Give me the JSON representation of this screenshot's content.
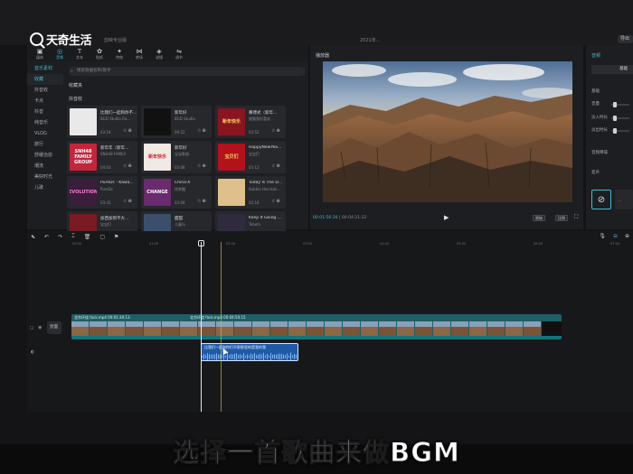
{
  "watermark": {
    "logo_text": "天奇生活"
  },
  "window": {
    "title": "剪映专业版",
    "project": "2021年..."
  },
  "header": {
    "export_label": "导出"
  },
  "media_panel": {
    "tools": [
      {
        "icon": "▣",
        "label": "媒体"
      },
      {
        "icon": "◎",
        "label": "音频"
      },
      {
        "icon": "T",
        "label": "文本"
      },
      {
        "icon": "✿",
        "label": "贴纸"
      },
      {
        "icon": "✦",
        "label": "特效"
      },
      {
        "icon": "⋈",
        "label": "转场"
      },
      {
        "icon": "◈",
        "label": "滤镜"
      },
      {
        "icon": "⇋",
        "label": "调节"
      }
    ],
    "categories": [
      "音乐素材",
      "收藏",
      "抖音收",
      "卡点",
      "抖音",
      "纯音乐",
      "VLOG",
      "旅行",
      "舒缓治愈",
      "潮流",
      "美好时光",
      "儿歌"
    ],
    "search_placeholder": "搜索歌曲名称/歌手",
    "section_recent": "收藏夹",
    "section_list": "抖音收",
    "tracks": [
      {
        "title": "比我们一起和你不...",
        "artist": "BGD Studio Ra...",
        "duration": "03:14"
      },
      {
        "title": "新年好",
        "artist": "BGD Studio",
        "duration": "00:22"
      },
      {
        "title": "赛博式（新年...",
        "artist": "猫猫我好喜欢...",
        "duration": "03:52"
      },
      {
        "title": "新年年（新年...",
        "artist": "SNH48 FAMILY",
        "duration": "04:03"
      },
      {
        "title": "新年好",
        "artist": "宝宝歌曲",
        "duration": "03:08"
      },
      {
        "title": "HappyNewYea...",
        "artist": "宝宝们",
        "duration": "03:12"
      },
      {
        "title": "PureDc - Kawa...",
        "artist": "PureDc",
        "duration": "03:41"
      },
      {
        "title": "China-X",
        "artist": "徐梦圆",
        "duration": "03:08"
      },
      {
        "title": "Today Is The D...",
        "artist": "Robbie Harrisok...",
        "duration": "02:16"
      },
      {
        "title": "加西加到不大...",
        "artist": "宝宝们",
        "duration": "03:15"
      },
      {
        "title": "甜甜",
        "artist": "儿童乐",
        "duration": "03:21"
      },
      {
        "title": "Keep It Going ...",
        "artist": "Tobela",
        "duration": "02:05"
      }
    ],
    "thumb_texts": [
      "",
      "",
      "新年快乐",
      "SNH48 FAMILY GROUP",
      "新年快乐",
      "宝贝们",
      "EVOLUTION",
      "CHANGE",
      "",
      "",
      "",
      ""
    ]
  },
  "player": {
    "label": "播放器",
    "current_time": "00:01:56:26",
    "total_time": "00:04:21:22",
    "btn_ratio": "原始",
    "btn_full": "比例"
  },
  "properties": {
    "label": "音频",
    "tab": "基础",
    "rows": [
      "基础",
      "音量",
      "淡入时长",
      "淡出时长",
      "音频降噪",
      "变声"
    ]
  },
  "timeline": {
    "ruler": [
      "00:00",
      "01:00",
      "02:00",
      "03:00",
      "04:00",
      "05:00",
      "06:00",
      "07:00"
    ],
    "cover_label": "封面",
    "video_clips": [
      {
        "label": "北京环绕 fack.mp4 00:01:30:13"
      },
      {
        "label": "北京环绕 fack.mp4 00:04:50:15"
      }
    ],
    "audio_clip": "比我们一起和你们不那那里的是我的我"
  },
  "caption": "选择一首歌曲来做BGM"
}
